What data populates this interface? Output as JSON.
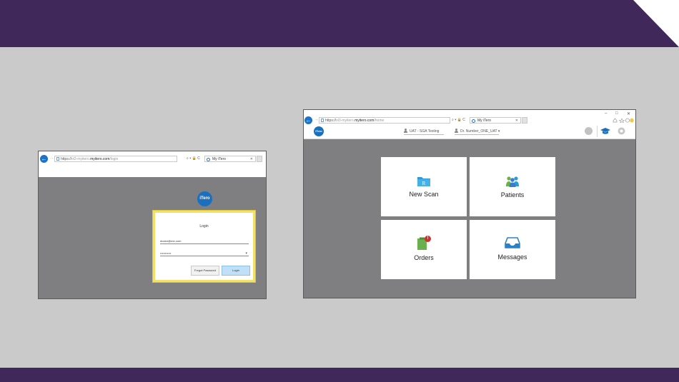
{
  "login_window": {
    "address": {
      "scheme": "https://",
      "subdomain": "ol3-myitero.",
      "host": "myitero.com",
      "path": "/login"
    },
    "address_tools": "⌕ ▾ 🔒 C",
    "tab_title": "My iTero",
    "logo_text": "iTero",
    "form": {
      "title": "Login",
      "email_value": "doctor@me.com",
      "password_value": "•••••••••••",
      "forgot_label": "Forgot Password",
      "login_label": "Login"
    }
  },
  "home_window": {
    "address": {
      "scheme": "https://",
      "subdomain": "ol3-myitero.",
      "host": "myitero.com",
      "path": "/home"
    },
    "address_tools": "⌕ ▾ 🔒 C",
    "tab_title": "My iTero",
    "window_controls": {
      "minimize": "–",
      "maximize": "□",
      "close": "✕"
    },
    "logo_text": "iTero",
    "practice": "UAT - SGA Testing",
    "doctor": "Dr. Number_ONE_UAT",
    "doctor_chevron": "▾",
    "tiles": [
      {
        "label": "New Scan",
        "icon": "folder-scan-icon"
      },
      {
        "label": "Patients",
        "icon": "patients-icon"
      },
      {
        "label": "Orders",
        "icon": "orders-icon",
        "badge": "!"
      },
      {
        "label": "Messages",
        "icon": "inbox-icon"
      }
    ]
  },
  "colors": {
    "slide_band": "#40295a",
    "slide_background": "#cacaca",
    "app_background": "#7f7f81",
    "brand_blue": "#1a6fbf",
    "highlight": "#f1e06a",
    "badge_red": "#d0312d"
  }
}
